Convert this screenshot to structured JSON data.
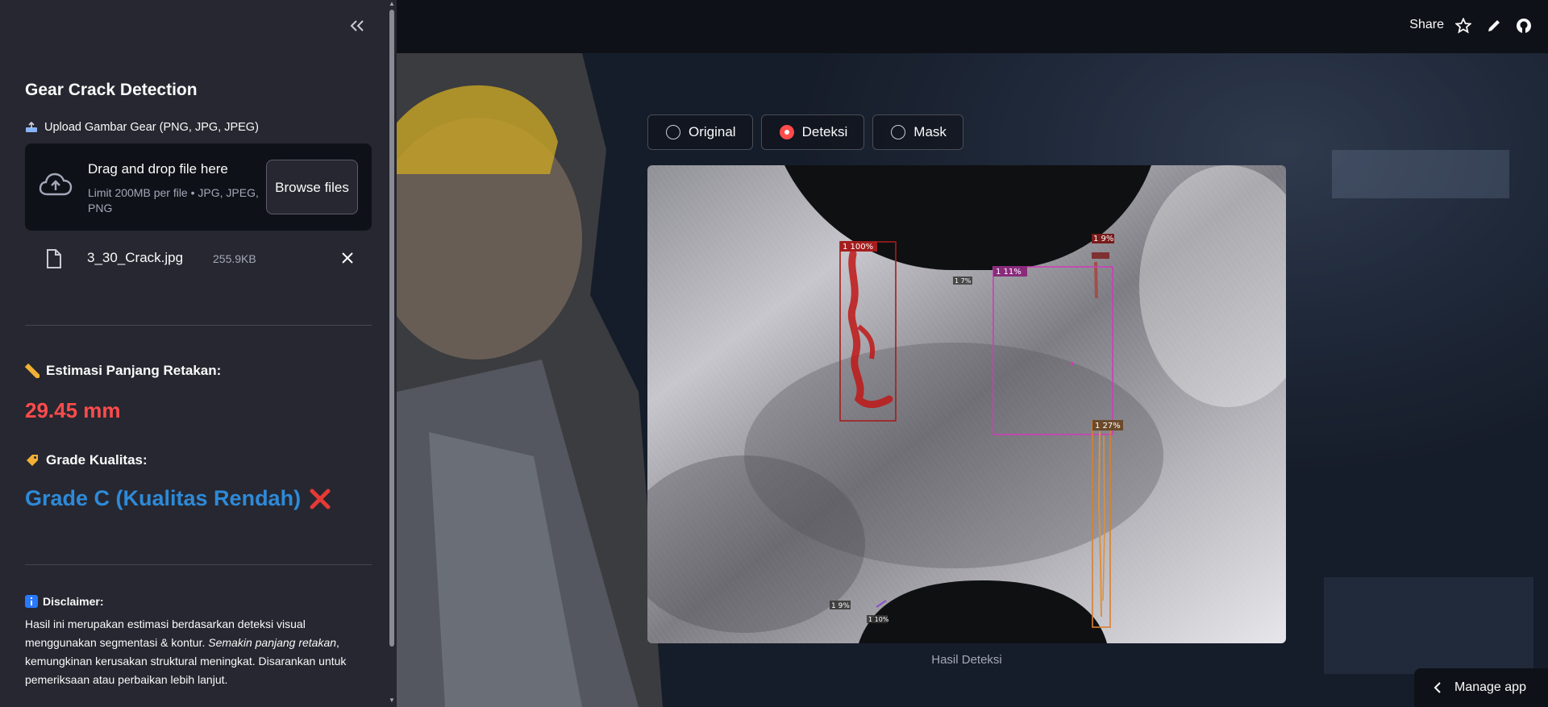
{
  "sidebar": {
    "title": "Gear Crack Detection",
    "upload_label": "Upload Gambar Gear (PNG, JPG, JPEG)",
    "dropzone": {
      "main": "Drag and drop file here",
      "sub": "Limit 200MB per file • JPG, JPEG, PNG",
      "browse": "Browse files"
    },
    "file": {
      "name": "3_30_Crack.jpg",
      "size": "255.9KB"
    },
    "length_label": "Estimasi Panjang Retakan:",
    "length_value": "29.45 mm",
    "grade_label": "Grade Kualitas:",
    "grade_value": "Grade C (Kualitas Rendah)",
    "disclaimer_title": "Disclaimer:",
    "disclaimer_text_1": "Hasil ini merupakan estimasi berdasarkan deteksi visual menggunakan segmentasi & kontur. ",
    "disclaimer_text_em": "Semakin panjang retakan",
    "disclaimer_text_2": ", kemungkinan kerusakan struktural meningkat. Disarankan untuk pemeriksaan atau perbaikan lebih lanjut."
  },
  "header": {
    "share": "Share"
  },
  "view_options": [
    {
      "label": "Original",
      "selected": false
    },
    {
      "label": "Deteksi",
      "selected": true
    },
    {
      "label": "Mask",
      "selected": false
    }
  ],
  "detection_labels": {
    "box1": "1 100%",
    "box2": "1 9%",
    "box3": "1 11%",
    "box4": "1 27%",
    "box5": "1 9%",
    "box6": "1 10%",
    "small1": "1 7%",
    "small2": "1 10%"
  },
  "image_caption": "Hasil Deteksi",
  "manage_app": "Manage app",
  "colors": {
    "accent": "#ff4b4b",
    "grade": "#2e8ad8",
    "sidebar_bg": "#262730",
    "main_bg": "#0e1117"
  }
}
